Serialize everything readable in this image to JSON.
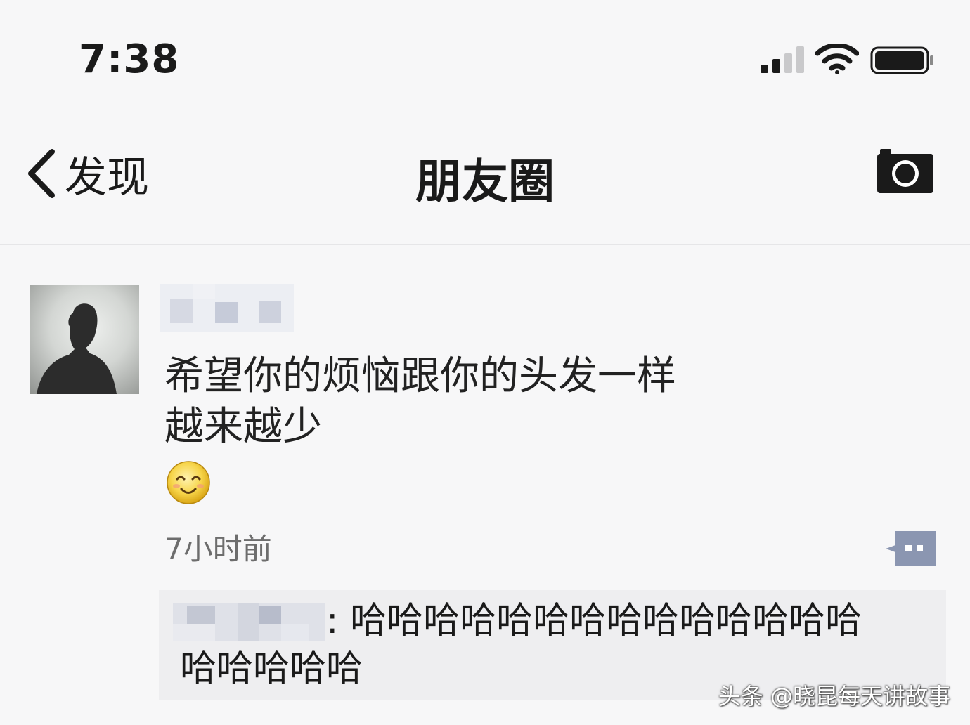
{
  "status_bar": {
    "time": "7:38",
    "icons": [
      "signal-icon",
      "wifi-icon",
      "battery-icon"
    ]
  },
  "nav": {
    "back_label": "发现",
    "title": "朋友圈",
    "camera_icon": "camera-icon"
  },
  "post": {
    "text_line1": "希望你的烦恼跟你的头发一样",
    "text_line2": "越来越少",
    "emoji": "smiling-face-emoji",
    "timestamp": "7小时前",
    "action_icon": "comment-dots-icon"
  },
  "comment": {
    "separator": ":",
    "text_line1": "哈哈哈哈哈哈哈哈哈哈哈哈哈哈",
    "text_line2": "哈哈哈哈哈"
  },
  "watermark": "头条 @晓昆每天讲故事",
  "colors": {
    "background": "#f7f7f8",
    "comment_bg": "#eeeef0",
    "text": "#1a1a1a",
    "timestamp": "#6d6d6d"
  }
}
